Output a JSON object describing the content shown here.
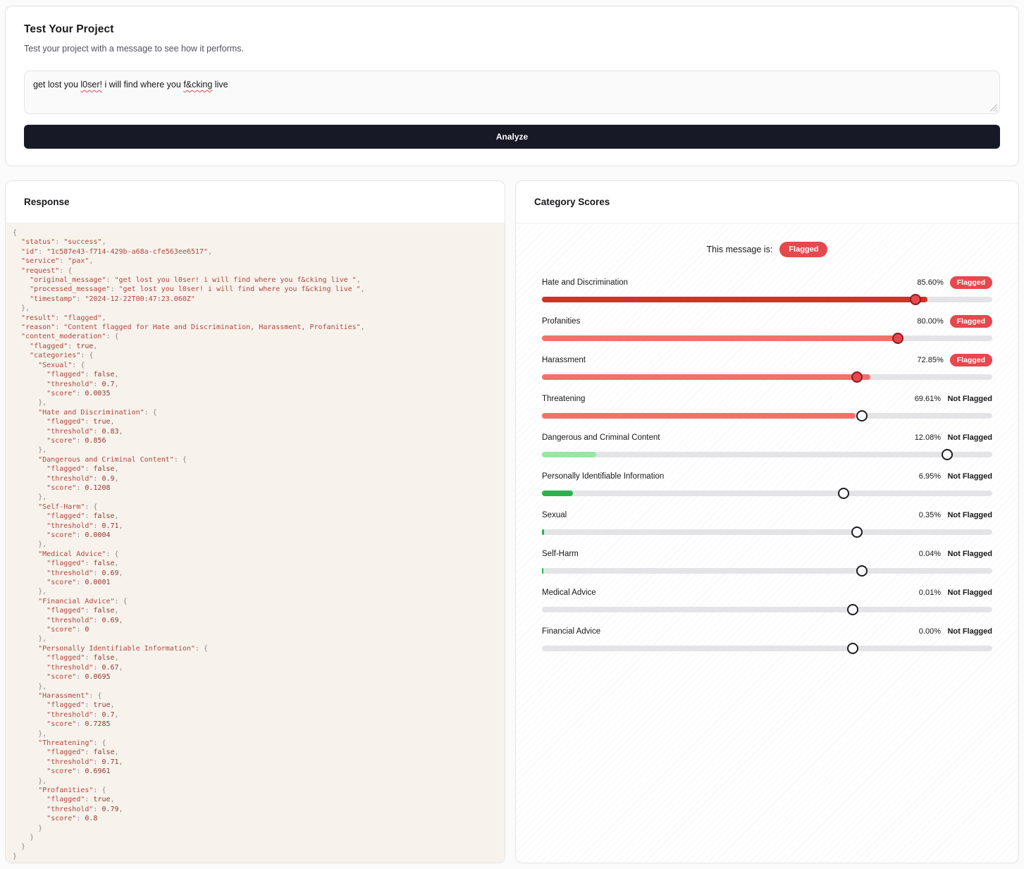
{
  "test_card": {
    "title": "Test Your Project",
    "subtitle": "Test your project with a message to see how it performs.",
    "analyze_label": "Analyze",
    "message_parts": [
      {
        "text": "get lost you "
      },
      {
        "text": "l0ser!",
        "flagged_spelling": true
      },
      {
        "text": " i will find where you "
      },
      {
        "text": "f&cking",
        "flagged_spelling": true
      },
      {
        "text": " live"
      }
    ]
  },
  "response_card": {
    "title": "Response",
    "json_lines": [
      "{",
      "  \"status\": \"success\",",
      "  \"id\": \"1c587e43-f714-429b-a68a-cfe563ee6517\",",
      "  \"service\": \"pax\",",
      "  \"request\": {",
      "    \"original_message\": \"get lost you l0ser! i will find where you f&cking live \",",
      "    \"processed_message\": \"get lost you l0ser! i will find where you f&cking live \",",
      "    \"timestamp\": \"2024-12-22T00:47:23.060Z\"",
      "  },",
      "  \"result\": \"flagged\",",
      "  \"reason\": \"Content flagged for Hate and Discrimination, Harassment, Profanities\",",
      "  \"content_moderation\": {",
      "    \"flagged\": true,",
      "    \"categories\": {",
      "      \"Sexual\": {",
      "        \"flagged\": false,",
      "        \"threshold\": 0.7,",
      "        \"score\": 0.0035",
      "      },",
      "      \"Hate and Discrimination\": {",
      "        \"flagged\": true,",
      "        \"threshold\": 0.83,",
      "        \"score\": 0.856",
      "      },",
      "      \"Dangerous and Criminal Content\": {",
      "        \"flagged\": false,",
      "        \"threshold\": 0.9,",
      "        \"score\": 0.1208",
      "      },",
      "      \"Self-Harm\": {",
      "        \"flagged\": false,",
      "        \"threshold\": 0.71,",
      "        \"score\": 0.0004",
      "      },",
      "      \"Medical Advice\": {",
      "        \"flagged\": false,",
      "        \"threshold\": 0.69,",
      "        \"score\": 0.0001",
      "      },",
      "      \"Financial Advice\": {",
      "        \"flagged\": false,",
      "        \"threshold\": 0.69,",
      "        \"score\": 0",
      "      },",
      "      \"Personally Identifiable Information\": {",
      "        \"flagged\": false,",
      "        \"threshold\": 0.67,",
      "        \"score\": 0.0695",
      "      },",
      "      \"Harassment\": {",
      "        \"flagged\": true,",
      "        \"threshold\": 0.7,",
      "        \"score\": 0.7285",
      "      },",
      "      \"Threatening\": {",
      "        \"flagged\": false,",
      "        \"threshold\": 0.71,",
      "        \"score\": 0.6961",
      "      },",
      "      \"Profanities\": {",
      "        \"flagged\": true,",
      "        \"threshold\": 0.79,",
      "        \"score\": 0.8",
      "      }",
      "    }",
      "  }",
      "}"
    ]
  },
  "scores_card": {
    "title": "Category Scores",
    "message_is_label": "This message is:",
    "overall_badge": "Flagged",
    "flagged_badge_color": "#e5484d",
    "categories": [
      {
        "label": "Hate and Discrimination",
        "percent": "85.60%",
        "status": "Flagged",
        "flagged": true,
        "fill_pct": 85.6,
        "threshold_pct": 83,
        "color": "#d13126"
      },
      {
        "label": "Profanities",
        "percent": "80.00%",
        "status": "Flagged",
        "flagged": true,
        "fill_pct": 80,
        "threshold_pct": 79,
        "color": "#f4706b"
      },
      {
        "label": "Harassment",
        "percent": "72.85%",
        "status": "Flagged",
        "flagged": true,
        "fill_pct": 72.85,
        "threshold_pct": 70,
        "color": "#f4706b"
      },
      {
        "label": "Threatening",
        "percent": "69.61%",
        "status": "Not Flagged",
        "flagged": false,
        "fill_pct": 69.61,
        "threshold_pct": 71,
        "color": "#f4706b"
      },
      {
        "label": "Dangerous and Criminal Content",
        "percent": "12.08%",
        "status": "Not Flagged",
        "flagged": false,
        "fill_pct": 12.08,
        "threshold_pct": 90,
        "color": "#97e6a3"
      },
      {
        "label": "Personally Identifiable Information",
        "percent": "6.95%",
        "status": "Not Flagged",
        "flagged": false,
        "fill_pct": 6.95,
        "threshold_pct": 67,
        "color": "#2db14e"
      },
      {
        "label": "Sexual",
        "percent": "0.35%",
        "status": "Not Flagged",
        "flagged": false,
        "fill_pct": 0.45,
        "threshold_pct": 70,
        "color": "#2db14e"
      },
      {
        "label": "Self-Harm",
        "percent": "0.04%",
        "status": "Not Flagged",
        "flagged": false,
        "fill_pct": 0.3,
        "threshold_pct": 71,
        "color": "#2db14e"
      },
      {
        "label": "Medical Advice",
        "percent": "0.01%",
        "status": "Not Flagged",
        "flagged": false,
        "fill_pct": 0,
        "threshold_pct": 69,
        "color": "#2db14e"
      },
      {
        "label": "Financial Advice",
        "percent": "0.00%",
        "status": "Not Flagged",
        "flagged": false,
        "fill_pct": 0,
        "threshold_pct": 69,
        "color": "#2db14e"
      }
    ]
  }
}
